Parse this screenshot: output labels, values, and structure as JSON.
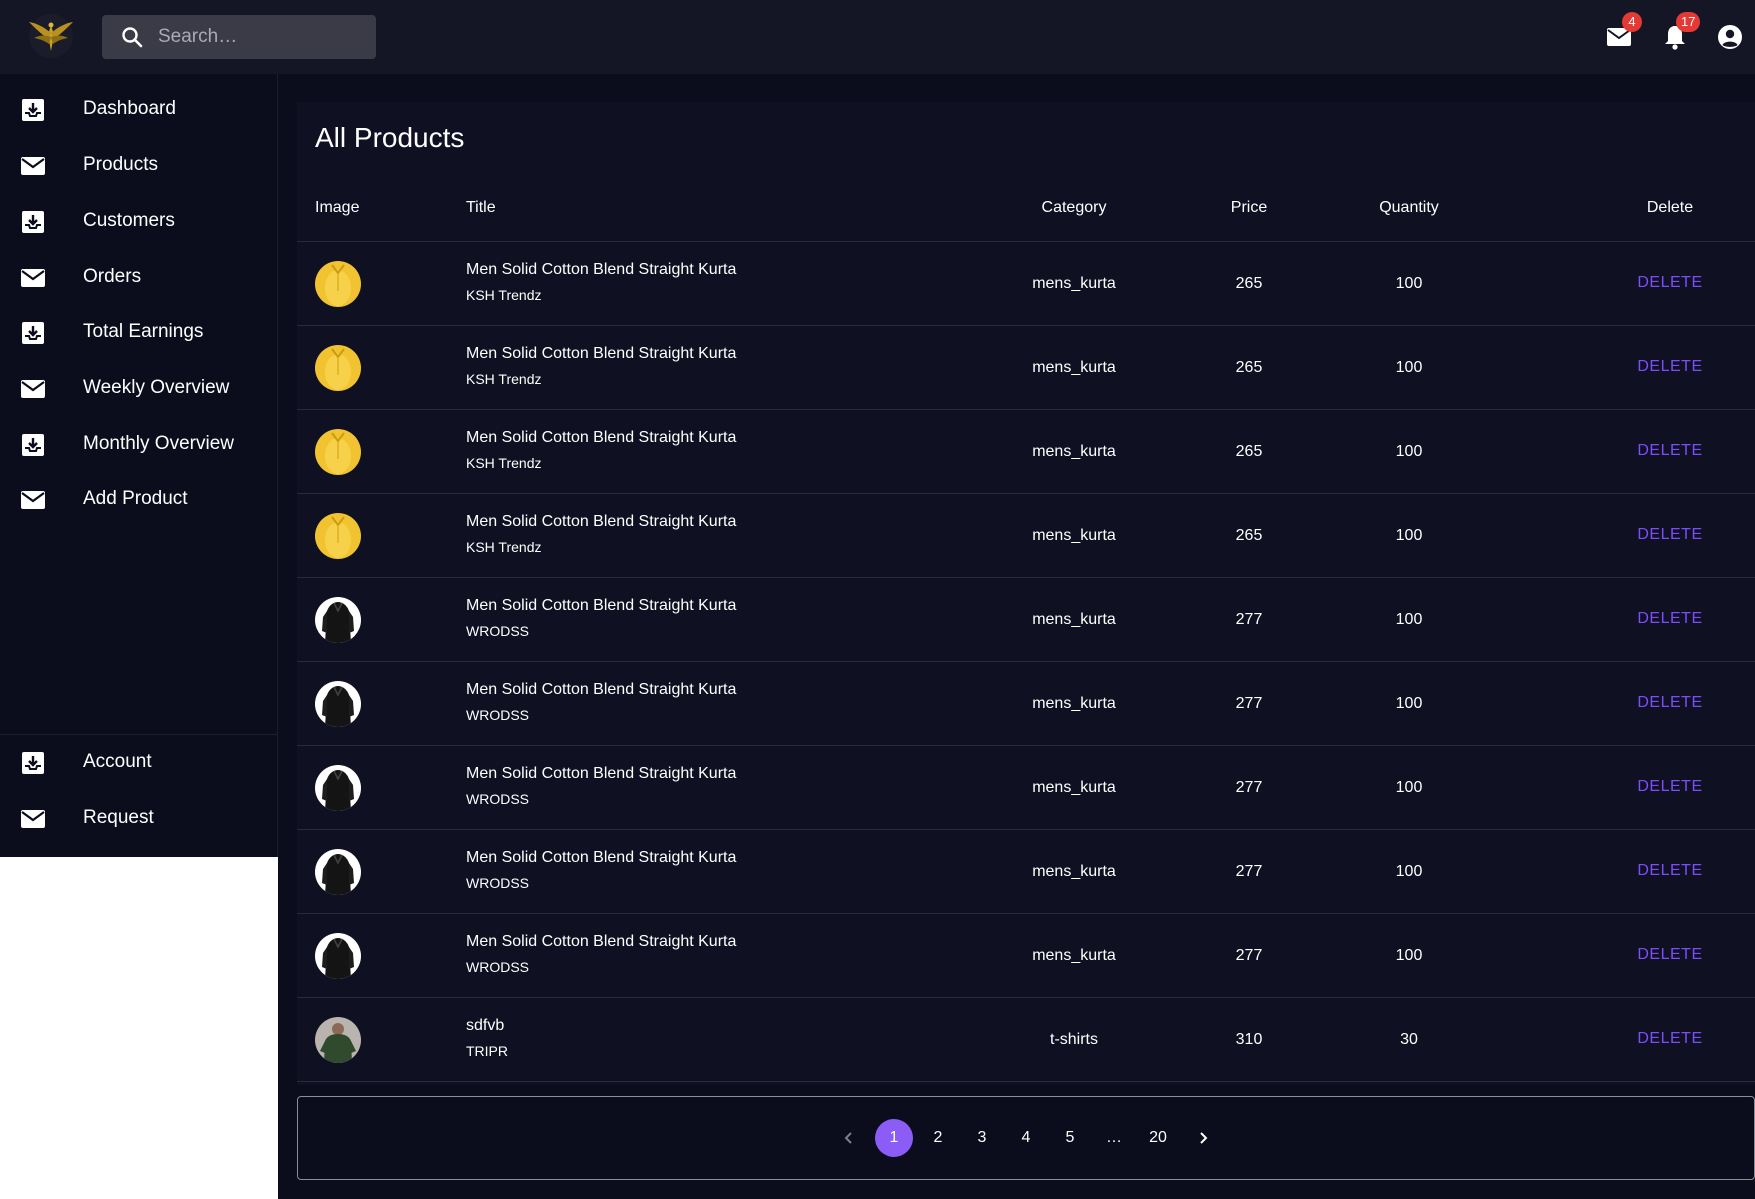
{
  "topbar": {
    "search_placeholder": "Search…",
    "mail_badge": "4",
    "notifications_badge": "17"
  },
  "sidebar": {
    "items": [
      {
        "label": "Dashboard",
        "icon": "inbox-download-icon"
      },
      {
        "label": "Products",
        "icon": "mail-icon"
      },
      {
        "label": "Customers",
        "icon": "inbox-download-icon"
      },
      {
        "label": "Orders",
        "icon": "mail-icon"
      },
      {
        "label": "Total Earnings",
        "icon": "inbox-download-icon"
      },
      {
        "label": "Weekly Overview",
        "icon": "mail-icon"
      },
      {
        "label": "Monthly Overview",
        "icon": "inbox-download-icon"
      },
      {
        "label": "Add Product",
        "icon": "mail-icon"
      }
    ],
    "bottom_items": [
      {
        "label": "Account",
        "icon": "inbox-download-icon"
      },
      {
        "label": "Request",
        "icon": "mail-icon"
      }
    ]
  },
  "main": {
    "title": "All Products",
    "columns": [
      "Image",
      "Title",
      "Category",
      "Price",
      "Quantity",
      "Delete"
    ],
    "rows": [
      {
        "title": "Men Solid Cotton Blend Straight Kurta",
        "brand": "KSH Trendz",
        "category": "mens_kurta",
        "price": "265",
        "quantity": "100",
        "action": "DELETE",
        "thumb": "yellow"
      },
      {
        "title": "Men Solid Cotton Blend Straight Kurta",
        "brand": "KSH Trendz",
        "category": "mens_kurta",
        "price": "265",
        "quantity": "100",
        "action": "DELETE",
        "thumb": "yellow"
      },
      {
        "title": "Men Solid Cotton Blend Straight Kurta",
        "brand": "KSH Trendz",
        "category": "mens_kurta",
        "price": "265",
        "quantity": "100",
        "action": "DELETE",
        "thumb": "yellow"
      },
      {
        "title": "Men Solid Cotton Blend Straight Kurta",
        "brand": "KSH Trendz",
        "category": "mens_kurta",
        "price": "265",
        "quantity": "100",
        "action": "DELETE",
        "thumb": "yellow"
      },
      {
        "title": "Men Solid Cotton Blend Straight Kurta",
        "brand": "WRODSS",
        "category": "mens_kurta",
        "price": "277",
        "quantity": "100",
        "action": "DELETE",
        "thumb": "black"
      },
      {
        "title": "Men Solid Cotton Blend Straight Kurta",
        "brand": "WRODSS",
        "category": "mens_kurta",
        "price": "277",
        "quantity": "100",
        "action": "DELETE",
        "thumb": "black"
      },
      {
        "title": "Men Solid Cotton Blend Straight Kurta",
        "brand": "WRODSS",
        "category": "mens_kurta",
        "price": "277",
        "quantity": "100",
        "action": "DELETE",
        "thumb": "black"
      },
      {
        "title": "Men Solid Cotton Blend Straight Kurta",
        "brand": "WRODSS",
        "category": "mens_kurta",
        "price": "277",
        "quantity": "100",
        "action": "DELETE",
        "thumb": "black"
      },
      {
        "title": "Men Solid Cotton Blend Straight Kurta",
        "brand": "WRODSS",
        "category": "mens_kurta",
        "price": "277",
        "quantity": "100",
        "action": "DELETE",
        "thumb": "black"
      },
      {
        "title": "sdfvb",
        "brand": "TRIPR",
        "category": "t-shirts",
        "price": "310",
        "quantity": "30",
        "action": "DELETE",
        "thumb": "green"
      }
    ]
  },
  "pagination": {
    "pages": [
      "1",
      "2",
      "3",
      "4",
      "5",
      "…",
      "20"
    ],
    "active_page": "1"
  },
  "colors": {
    "accent": "#8b5cf6",
    "delete_link": "#7c4dff",
    "badge": "#e53935",
    "topbar": "#151625",
    "card": "#0f1022"
  }
}
